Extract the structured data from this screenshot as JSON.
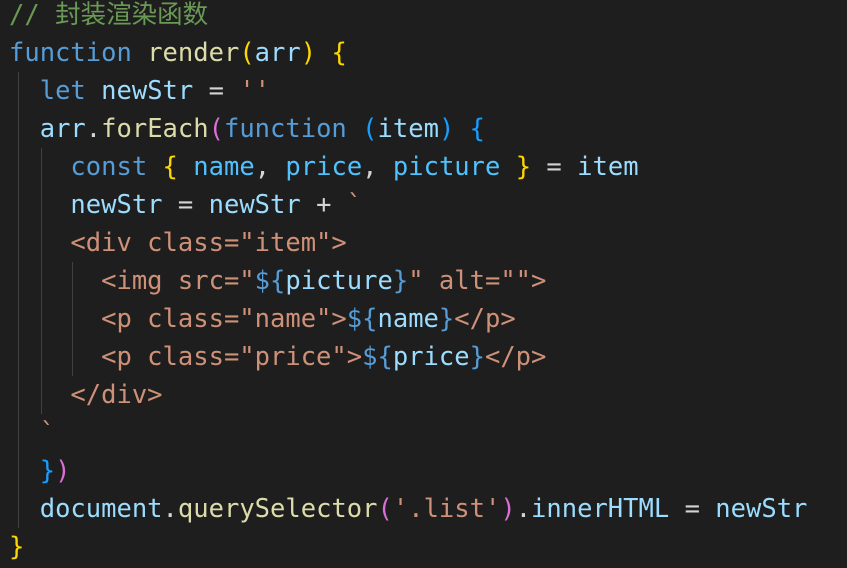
{
  "code": {
    "comment_prefix": "// ",
    "comment_text": "封装渲染函数",
    "l2_function": "function",
    "l2_name": "render",
    "l2_open": "(",
    "l2_param": "arr",
    "l2_close": ")",
    "l2_brace": "{",
    "l3_let": "let",
    "l3_var": "newStr",
    "l3_eq": " = ",
    "l3_str": "''",
    "l4_arr": "arr",
    "l4_dot": ".",
    "l4_method": "forEach",
    "l4_open": "(",
    "l4_function": "function",
    "l4_popen": "(",
    "l4_param": "item",
    "l4_pclose": ")",
    "l4_brace": "{",
    "l5_const": "const",
    "l5_open": "{",
    "l5_name": "name",
    "l5_comma1": ", ",
    "l5_price": "price",
    "l5_comma2": ", ",
    "l5_picture": "picture",
    "l5_close": "}",
    "l5_eq": " = ",
    "l5_item": "item",
    "l6_var": "newStr",
    "l6_eq": " = ",
    "l6_var2": "newStr",
    "l6_plus": " + ",
    "l6_tick": "`",
    "l7_str": "<div class=\"item\">",
    "l8_str1": "<img src=\"",
    "l8_dollar": "${",
    "l8_var": "picture",
    "l8_close": "}",
    "l8_str2": "\" alt=\"\">",
    "l9_str1": "<p class=\"name\">",
    "l9_dollar": "${",
    "l9_var": "name",
    "l9_close": "}",
    "l9_str2": "</p>",
    "l10_str1": "<p class=\"price\">",
    "l10_dollar": "${",
    "l10_var": "price",
    "l10_close": "}",
    "l10_str2": "</p>",
    "l11_str": "</div>",
    "l12_tick": "`",
    "l13_brace": "}",
    "l13_paren": ")",
    "l14_obj": "document",
    "l14_dot1": ".",
    "l14_method": "querySelector",
    "l14_open": "(",
    "l14_str": "'.list'",
    "l14_close": ")",
    "l14_dot2": ".",
    "l14_prop": "innerHTML",
    "l14_eq": " = ",
    "l14_var": "newStr",
    "l15_brace": "}"
  },
  "colors": {
    "background": "#1e1e1e",
    "comment": "#6a9955",
    "keyword": "#569cd6",
    "function": "#dcdcaa",
    "variable": "#9cdcfe",
    "constant": "#4fc1ff",
    "string": "#ce9178",
    "text": "#d4d4d4",
    "bracket_level1": "#ffd700",
    "bracket_level2": "#da70d6",
    "bracket_level3": "#179fff"
  }
}
